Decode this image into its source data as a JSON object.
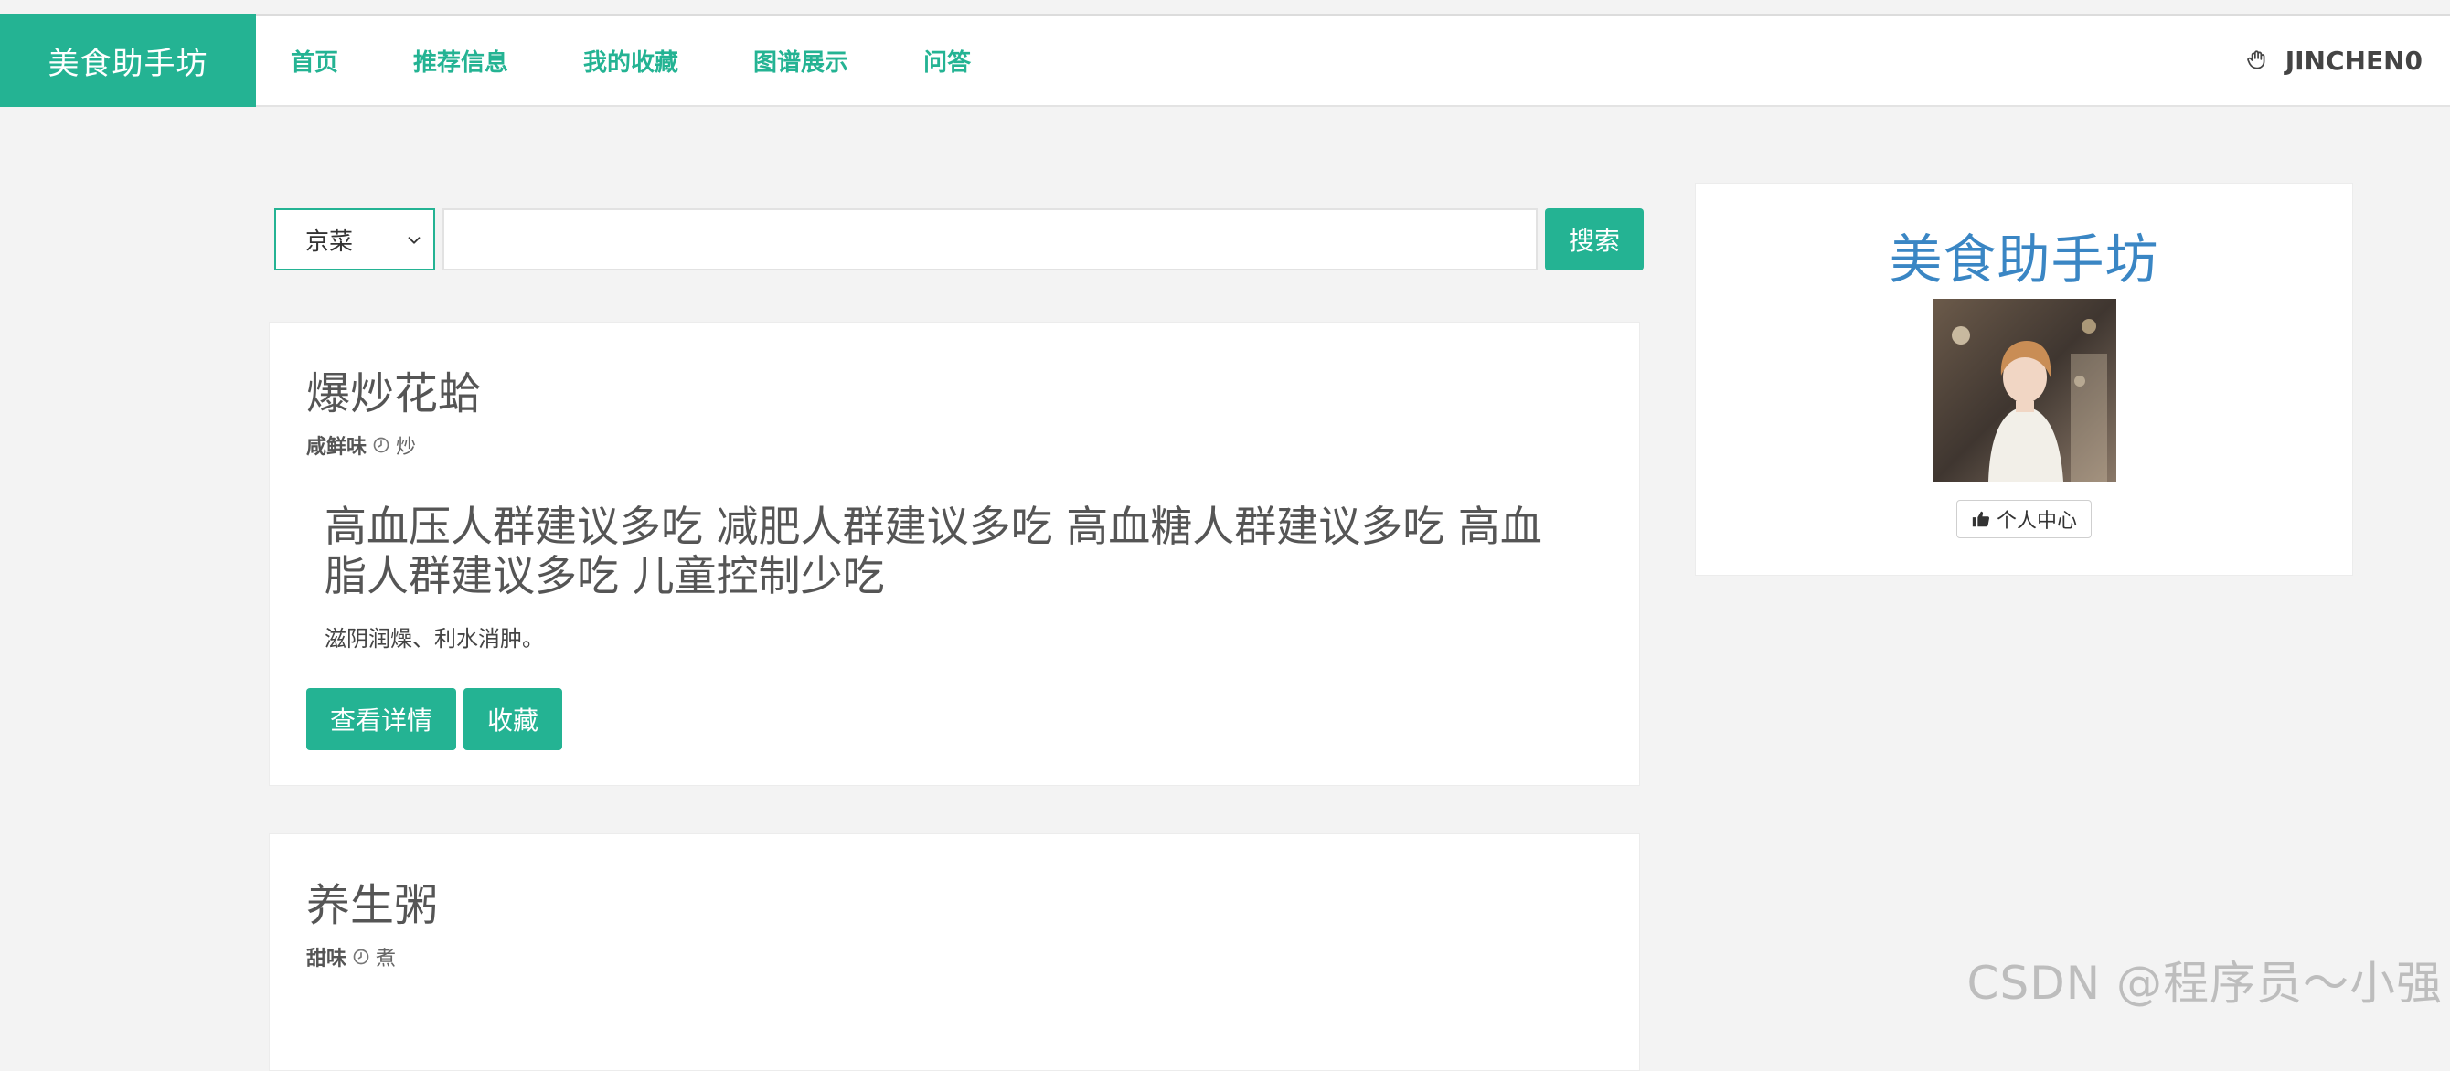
{
  "nav": {
    "brand": "美食助手坊",
    "links": [
      "首页",
      "推荐信息",
      "我的收藏",
      "图谱展示",
      "问答"
    ],
    "user": "JINCHEN0"
  },
  "search": {
    "select_value": "京菜",
    "input_value": "",
    "button": "搜索"
  },
  "cards": [
    {
      "title": "爆炒花蛤",
      "taste": "咸鲜味",
      "method": "炒",
      "desc": "高血压人群建议多吃 减肥人群建议多吃 高血糖人群建议多吃 高血脂人群建议多吃 儿童控制少吃",
      "sub": "滋阴润燥、利水消肿。",
      "btn_detail": "查看详情",
      "btn_fav": "收藏"
    },
    {
      "title": "养生粥",
      "taste": "甜味",
      "method": "煮"
    }
  ],
  "profile": {
    "title": "美食助手坊",
    "button": "个人中心"
  },
  "watermark": "CSDN @程序员～小强",
  "colors": {
    "accent": "#24b393",
    "profile_title": "#3a86c4"
  },
  "icons": {
    "user": "hand-icon",
    "time": "clock-icon",
    "profile": "thumbs-up-icon",
    "select": "chevron-down-icon"
  }
}
